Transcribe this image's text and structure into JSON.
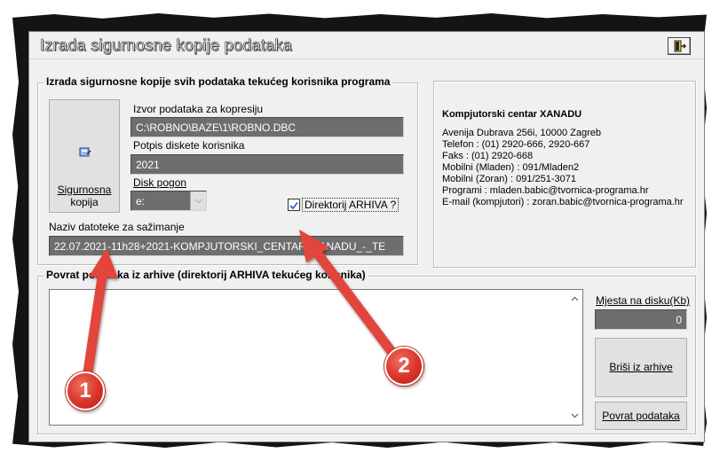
{
  "window": {
    "title": "Izrada sigurnosne kopije podataka"
  },
  "backup_group": {
    "legend": "Izrada sigurnosne kopije svih podataka tekućeg korisnika programa",
    "backup_button": {
      "line1": "Sigurnosna",
      "line2": "kopija"
    },
    "source_label": "Izvor podataka za kopresiju",
    "source_value": "C:\\ROBNO\\BAZE\\1\\ROBNO.DBC",
    "signature_label": "Potpis diskete korisnika",
    "signature_value": "2021",
    "disk_label": "Disk pogon",
    "disk_value": "e:",
    "archive_checkbox_label": "Direktorij ARHIVA ?",
    "archive_checked": true,
    "filename_label": "Naziv datoteke za sažimanje",
    "filename_value": "22.07.2021-11h28+2021-KOMPJUTORSKI_CENTAR_XANADU_-_TE"
  },
  "company_info": {
    "name": "Kompjutorski centar XANADU",
    "lines": [
      "Avenija Dubrava 256i, 10000 Zagreb",
      "Telefon : (01) 2920-666, 2920-667",
      "Faks : (01) 2920-668",
      "Mobilni (Mladen) : 091/Mladen2",
      "Mobilni (Zoran) : 091/251-3071",
      "Programi : mladen.babic@tvornica-programa.hr",
      "E-mail (kompjutori) : zoran.babic@tvornica-programa.hr"
    ]
  },
  "restore_group": {
    "legend": "Povrat podataka iz arhive (direktorij ARHIVA tekućeg korisnika)",
    "disk_space_label": "Mjesta na disku(Kb)",
    "disk_space_value": "0",
    "delete_button": "Briši iz arhive",
    "restore_button": "Povrat podataka"
  },
  "annotations": {
    "badge1": "1",
    "badge2": "2",
    "color": "#d9342a"
  }
}
